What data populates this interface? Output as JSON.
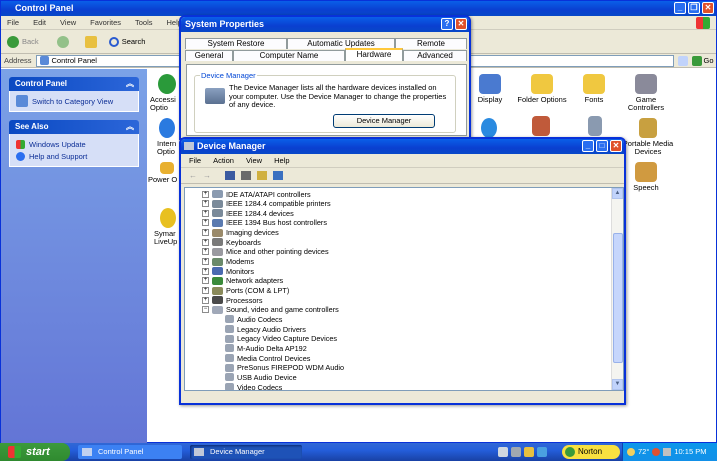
{
  "control_panel": {
    "title": "Control Panel",
    "menu": [
      "File",
      "Edit",
      "View",
      "Favorites",
      "Tools",
      "Help"
    ],
    "toolbar": {
      "back_label": "Back",
      "search_label": "Search"
    },
    "address": {
      "label": "Address",
      "value": "Control Panel",
      "go_label": "Go"
    },
    "sidebar": {
      "panel_title": "Control Panel",
      "switch_view_label": "Switch to Category View",
      "see_also_title": "See Also",
      "see_also_items": [
        "Windows Update",
        "Help and Support"
      ]
    },
    "items": [
      {
        "label": "Accessi\nOptio"
      },
      {
        "label": "Intern\nOptio"
      },
      {
        "label": "Power O"
      },
      {
        "label": "Symar\nLiveUp"
      },
      {
        "label": "Display"
      },
      {
        "label": "Folder Options"
      },
      {
        "label": "Fonts"
      },
      {
        "label": "Game\nControllers"
      },
      {
        "label": "Portable Media\nDevices"
      },
      {
        "label": "Speech"
      }
    ]
  },
  "system_properties": {
    "title": "System Properties",
    "tabs_row1": [
      "System Restore",
      "Automatic Updates",
      "Remote"
    ],
    "tabs_row2": [
      "General",
      "Computer Name",
      "Hardware",
      "Advanced"
    ],
    "selected_tab": "Hardware",
    "group_label": "Device Manager",
    "description": "The Device Manager lists all the hardware devices installed on your computer. Use the Device Manager to change the properties of any device.",
    "button_label": "Device Manager"
  },
  "device_manager": {
    "title": "Device Manager",
    "menu": [
      "File",
      "Action",
      "View",
      "Help"
    ],
    "tree": [
      {
        "label": "IDE ATA/ATAPI controllers",
        "expanded": false
      },
      {
        "label": "IEEE 1284.4 compatible printers",
        "expanded": false
      },
      {
        "label": "IEEE 1284.4 devices",
        "expanded": false
      },
      {
        "label": "IEEE 1394 Bus host controllers",
        "expanded": false
      },
      {
        "label": "Imaging devices",
        "expanded": false
      },
      {
        "label": "Keyboards",
        "expanded": false
      },
      {
        "label": "Mice and other pointing devices",
        "expanded": false
      },
      {
        "label": "Modems",
        "expanded": false
      },
      {
        "label": "Monitors",
        "expanded": false
      },
      {
        "label": "Network adapters",
        "expanded": false
      },
      {
        "label": "Ports (COM & LPT)",
        "expanded": false
      },
      {
        "label": "Processors",
        "expanded": false
      },
      {
        "label": "Sound, video and game controllers",
        "expanded": true
      }
    ],
    "children": [
      "Audio Codecs",
      "Legacy Audio Drivers",
      "Legacy Video Capture Devices",
      "M-Audio Delta AP192",
      "Media Control Devices",
      "PreSonus FIREPOD WDM Audio",
      "USB Audio Device",
      "Video Codecs"
    ]
  },
  "taskbar": {
    "start_label": "start",
    "tasks": [
      "Control Panel",
      "Device Manager"
    ],
    "norton_label": "Norton",
    "tray_text": "72°",
    "clock": "10:15 PM"
  },
  "colors": {
    "xp_blue": "#0a5fe8",
    "start_green": "#3c9a3c",
    "taskbar_blue": "#245edb"
  }
}
